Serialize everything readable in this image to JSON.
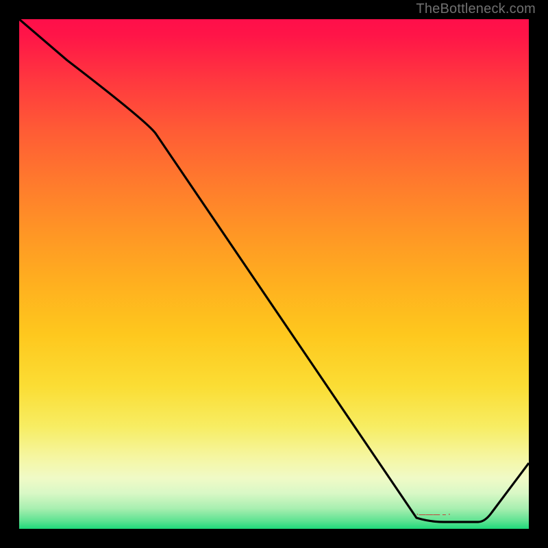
{
  "watermark": "TheBottleneck.com",
  "chart_data": {
    "type": "line",
    "title": "",
    "xlabel": "",
    "ylabel": "",
    "xlim": [
      0,
      100
    ],
    "ylim": [
      0,
      100
    ],
    "x": [
      0,
      26,
      78,
      90,
      100
    ],
    "values": [
      100,
      80,
      2,
      2,
      15
    ],
    "grid": false,
    "legend": false,
    "gradient": {
      "direction": "vertical",
      "stops": [
        {
          "pos": 0,
          "color": "#ff0f4a"
        },
        {
          "pos": 0.5,
          "color": "#ffb020"
        },
        {
          "pos": 0.85,
          "color": "#f5f6a2"
        },
        {
          "pos": 1.0,
          "color": "#1fd97a"
        }
      ]
    },
    "annotations": [
      {
        "text": "·——— – ·",
        "x": 84,
        "y": 2
      }
    ]
  },
  "annotation_text": "·——— – ·"
}
